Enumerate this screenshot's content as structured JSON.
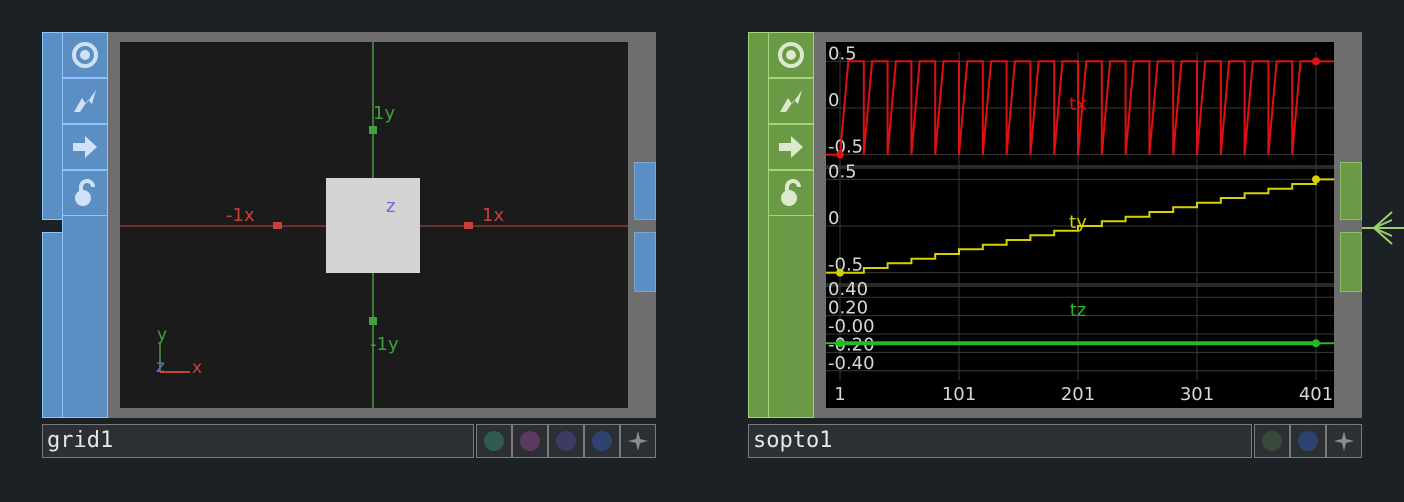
{
  "nodes": {
    "grid": {
      "name": "grid1",
      "icons": [
        "viewer-active-icon",
        "cook-icon",
        "export-icon",
        "lock-icon"
      ],
      "viewer": {
        "axis_y_pos": "1y",
        "axis_y_neg": "-1y",
        "axis_x_pos": "1x",
        "axis_x_neg": "-1x",
        "z_label": "z",
        "gizmo": {
          "y": "y",
          "x": "x",
          "z": "z"
        }
      },
      "flags": [
        {
          "name": "flag-teal",
          "color": "#2f5a52"
        },
        {
          "name": "flag-purple",
          "color": "#5a3a60"
        },
        {
          "name": "flag-violet",
          "color": "#3d3a66"
        },
        {
          "name": "flag-blue",
          "color": "#2f4370"
        },
        {
          "name": "flag-options",
          "color": "#8c8c8c"
        }
      ],
      "accent": "#5b8fc4"
    },
    "sopto": {
      "name": "sopto1",
      "icons": [
        "viewer-active-icon",
        "cook-icon",
        "export-icon",
        "lock-icon"
      ],
      "accent": "#6a9a46",
      "flags": [
        {
          "name": "flag-green",
          "color": "#3a4a38"
        },
        {
          "name": "flag-blue",
          "color": "#2f4370"
        },
        {
          "name": "flag-options",
          "color": "#8c8c8c"
        }
      ]
    }
  },
  "chart_data": {
    "type": "line",
    "x_ticks": [
      "1",
      "101",
      "201",
      "301",
      "401"
    ],
    "xlim": [
      1,
      401
    ],
    "series": [
      {
        "name": "tx",
        "color": "#dd1111",
        "y_ticks": [
          "0.5",
          "0",
          "-0.5"
        ],
        "ylim": [
          -0.6,
          0.6
        ],
        "pattern": "sawtooth",
        "cycles": 20,
        "min": -0.5,
        "max": 0.5,
        "first": -0.5,
        "last": 0.5
      },
      {
        "name": "ty",
        "color": "#d8d000",
        "y_ticks": [
          "0.5",
          "0",
          "-0.5"
        ],
        "ylim": [
          -0.6,
          0.6
        ],
        "pattern": "staircase",
        "steps": 20,
        "start": -0.5,
        "end": 0.5
      },
      {
        "name": "tz",
        "color": "#22bb22",
        "y_ticks": [
          "0.40",
          "0.20",
          "-0.00",
          "-0.20",
          "-0.40"
        ],
        "ylim": [
          -0.5,
          0.5
        ],
        "pattern": "constant",
        "value": -0.1
      }
    ]
  }
}
